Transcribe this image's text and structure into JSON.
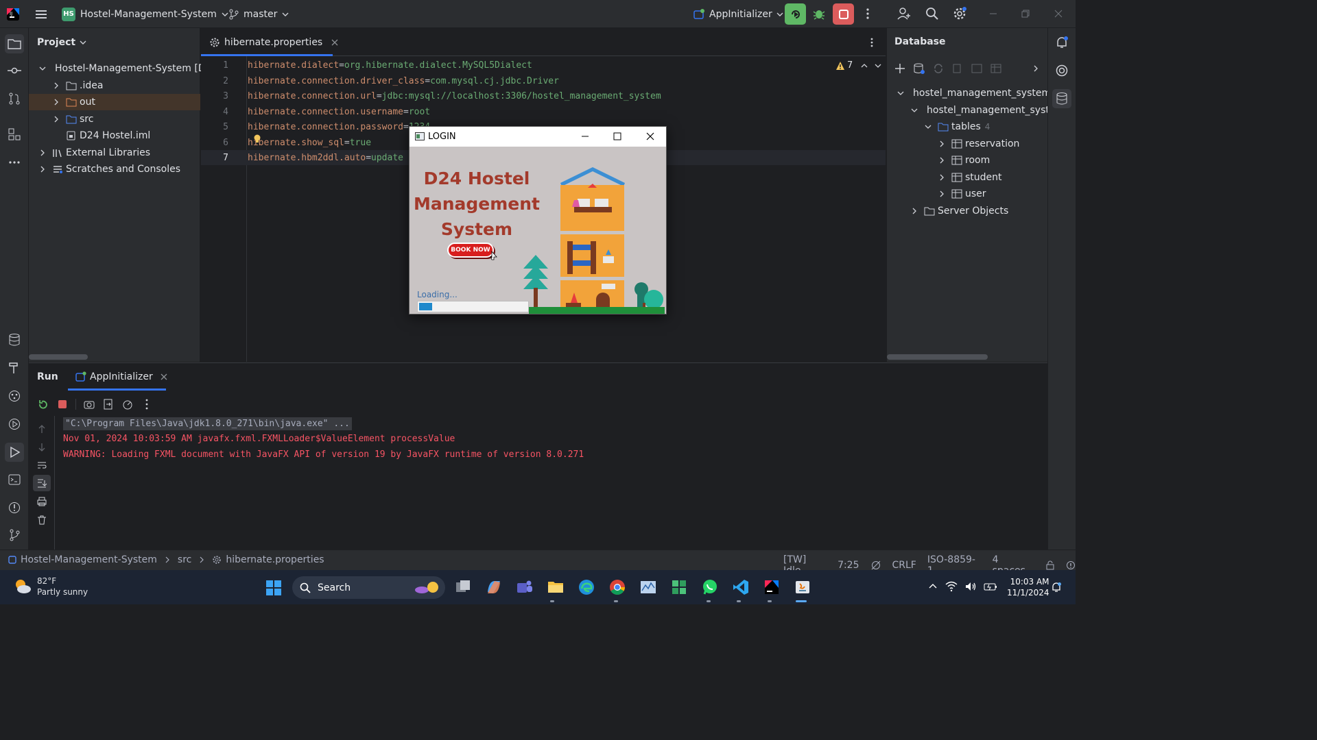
{
  "titlebar": {
    "project_badge": "HS",
    "project_name": "Hostel-Management-System",
    "branch": "master",
    "run_config": "AppInitializer"
  },
  "project_panel": {
    "title": "Project",
    "items": [
      {
        "label": "Hostel-Management-System [D"
      },
      {
        "label": ".idea"
      },
      {
        "label": "out"
      },
      {
        "label": "src"
      },
      {
        "label": "D24 Hostel.iml"
      },
      {
        "label": "External Libraries"
      },
      {
        "label": "Scratches and Consoles"
      }
    ]
  },
  "editor": {
    "tab_label": "hibernate.properties",
    "warning_count": "7",
    "lines": [
      {
        "num": "1",
        "key": "hibernate.dialect",
        "value": "org.hibernate.dialect.MySQL5Dialect"
      },
      {
        "num": "2",
        "key": "hibernate.connection.driver_class",
        "value": "com.mysql.cj.jdbc.Driver"
      },
      {
        "num": "3",
        "key": "hibernate.connection.url",
        "value": "jdbc:mysql://localhost:3306/hostel_management_system"
      },
      {
        "num": "4",
        "key": "hibernate.connection.username",
        "value": "root"
      },
      {
        "num": "5",
        "key": "hibernate.connection.password",
        "value": "1234"
      },
      {
        "num": "6",
        "key": "hibernate.show_sql",
        "value": "true"
      },
      {
        "num": "7",
        "key": "hibernate.hbm2ddl.auto",
        "value": "update"
      }
    ]
  },
  "database_panel": {
    "title": "Database",
    "datasource": "hostel_management_system",
    "schema": "hostel_management_syst",
    "tables_label": "tables",
    "tables_count": "4",
    "tables": [
      {
        "label": "reservation"
      },
      {
        "label": "room"
      },
      {
        "label": "student"
      },
      {
        "label": "user"
      }
    ],
    "server_objects": "Server Objects"
  },
  "login_window": {
    "title": "LOGIN",
    "heading_line1": "D24 Hostel",
    "heading_line2": "Management",
    "heading_line3": "System",
    "book_button": "BOOK NOW",
    "loading_label": "Loading...",
    "progress": 0.12
  },
  "run_panel": {
    "title": "Run",
    "tab_label": "AppInitializer",
    "console": [
      "\"C:\\Program Files\\Java\\jdk1.8.0_271\\bin\\java.exe\" ...",
      "Nov 01, 2024 10:03:59 AM javafx.fxml.FXMLLoader$ValueElement processValue",
      "WARNING: Loading FXML document with JavaFX API of version 19 by JavaFX runtime of version 8.0.271"
    ]
  },
  "statusbar": {
    "crumbs": [
      "Hostel-Management-System",
      "src",
      "hibernate.properties"
    ],
    "idle": "[TW] Idle",
    "position": "7:25",
    "line_sep": "CRLF",
    "encoding": "ISO-8859-1",
    "indent": "4 spaces"
  },
  "taskbar": {
    "temperature": "82°F",
    "weather": "Partly sunny",
    "search_label": "Search",
    "time": "10:03 AM",
    "date": "11/1/2024"
  },
  "colors": {
    "ide_bg": "#1e1f22",
    "panel_bg": "#2b2d30",
    "accent_blue": "#3574f0",
    "run_green": "#5fb865",
    "stop_red": "#db5c5c",
    "console_red": "#f75464",
    "code_key": "#cf8e6d",
    "code_value": "#6aab73",
    "login_title": "#a33a2b"
  }
}
